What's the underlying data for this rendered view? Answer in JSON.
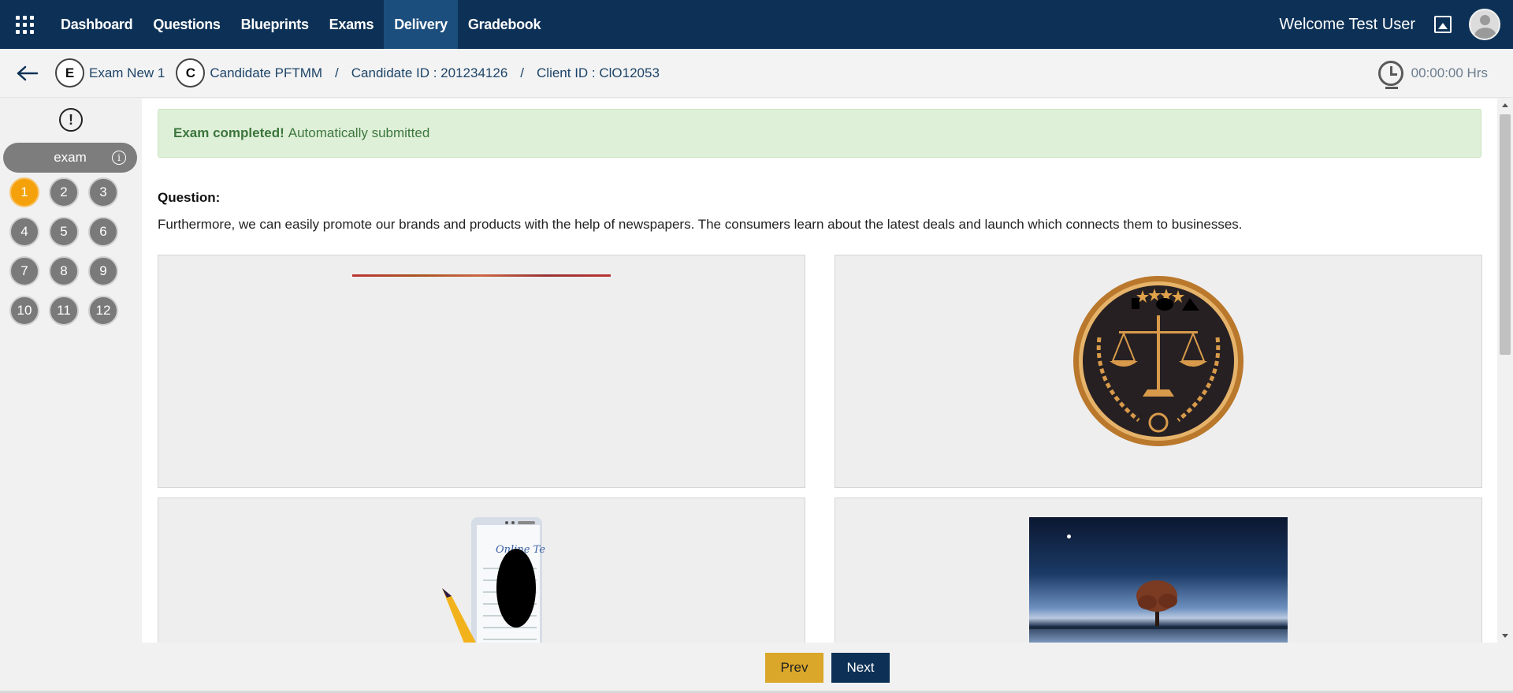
{
  "nav": {
    "items": [
      {
        "label": "Dashboard",
        "active": false
      },
      {
        "label": "Questions",
        "active": false
      },
      {
        "label": "Blueprints",
        "active": false
      },
      {
        "label": "Exams",
        "active": false
      },
      {
        "label": "Delivery",
        "active": true
      },
      {
        "label": "Gradebook",
        "active": false
      }
    ],
    "welcome": "Welcome Test User"
  },
  "breadcrumb": {
    "exam_badge": "E",
    "exam_name": "Exam New 1",
    "candidate_badge": "C",
    "candidate_name": "Candidate PFTMM",
    "separator": "/",
    "candidate_id": "Candidate ID : 201234126",
    "client_id": "Client ID : ClO12053",
    "timer": "00:00:00 Hrs"
  },
  "sidebar": {
    "alert_glyph": "!",
    "section_label": "exam",
    "info_glyph": "i",
    "current_question": 1,
    "questions": [
      "1",
      "2",
      "3",
      "4",
      "5",
      "6",
      "7",
      "8",
      "9",
      "10",
      "11",
      "12"
    ]
  },
  "main": {
    "alert_strong": "Exam completed!",
    "alert_text": "Automatically submitted",
    "question_label": "Question:",
    "question_text": "Furthermore, we can easily promote our brands and products with the help of newspapers. The consumers learn about the latest deals and launch which connects them to businesses."
  },
  "icons": {
    "apps": "apps-grid-icon",
    "back": "back-arrow-icon",
    "clock": "clock-icon",
    "image": "image-icon",
    "avatar": "user-avatar-icon"
  },
  "footer": {
    "prev_label": "Prev",
    "next_label": "Next"
  },
  "colors": {
    "nav_bg": "#0d3156",
    "nav_active": "#1b4e7c",
    "current_question": "#f5a10b",
    "question_default": "#7a7a7a",
    "success_bg": "#dff0d8",
    "success_text": "#3c763d",
    "prev_button": "#dba72a",
    "next_button": "#0d3156"
  }
}
